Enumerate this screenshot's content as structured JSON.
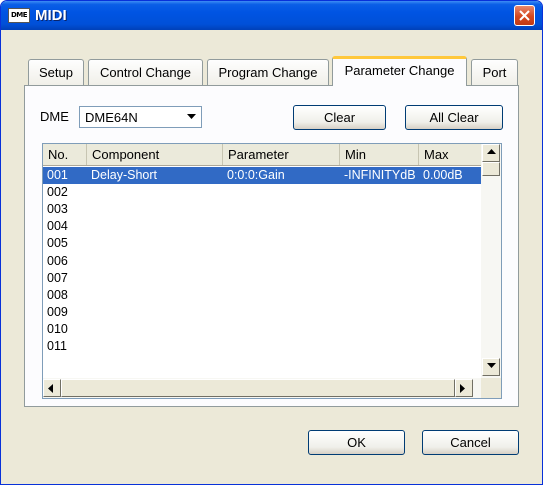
{
  "window": {
    "title": "MIDI",
    "icon_text": "DME"
  },
  "tabs": [
    {
      "label": "Setup",
      "active": false
    },
    {
      "label": "Control Change",
      "active": false
    },
    {
      "label": "Program Change",
      "active": false
    },
    {
      "label": "Parameter Change",
      "active": true
    },
    {
      "label": "Port",
      "active": false
    }
  ],
  "dme": {
    "label": "DME",
    "selected": "DME64N"
  },
  "buttons": {
    "clear": "Clear",
    "all_clear": "All Clear",
    "ok": "OK",
    "cancel": "Cancel"
  },
  "table": {
    "columns": [
      "No.",
      "Component",
      "Parameter",
      "Min",
      "Max"
    ],
    "rows": [
      {
        "no": "001",
        "component": "Delay-Short",
        "parameter": "0:0:0:Gain",
        "min": "-INFINITYdB",
        "max": "0.00dB"
      },
      {
        "no": "002",
        "component": "",
        "parameter": "",
        "min": "",
        "max": ""
      },
      {
        "no": "003",
        "component": "",
        "parameter": "",
        "min": "",
        "max": ""
      },
      {
        "no": "004",
        "component": "",
        "parameter": "",
        "min": "",
        "max": ""
      },
      {
        "no": "005",
        "component": "",
        "parameter": "",
        "min": "",
        "max": ""
      },
      {
        "no": "006",
        "component": "",
        "parameter": "",
        "min": "",
        "max": ""
      },
      {
        "no": "007",
        "component": "",
        "parameter": "",
        "min": "",
        "max": ""
      },
      {
        "no": "008",
        "component": "",
        "parameter": "",
        "min": "",
        "max": ""
      },
      {
        "no": "009",
        "component": "",
        "parameter": "",
        "min": "",
        "max": ""
      },
      {
        "no": "010",
        "component": "",
        "parameter": "",
        "min": "",
        "max": ""
      },
      {
        "no": "011",
        "component": "",
        "parameter": "",
        "min": "",
        "max": ""
      }
    ]
  }
}
